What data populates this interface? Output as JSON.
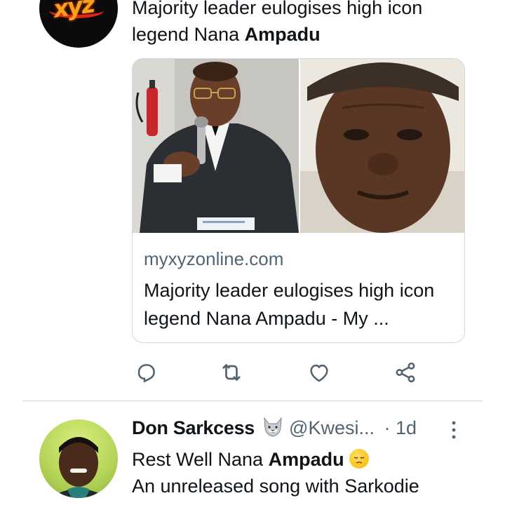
{
  "tweet1": {
    "avatar_icon": "xyz-logo-icon",
    "avatar_logo_text": "xyz",
    "text_prefix": "Majority leader eulogises high icon legend Nana ",
    "text_bold": "Ampadu",
    "card": {
      "domain": "myxyzonline.com",
      "title": "Majority leader eulogises high icon legend Nana Ampadu - My ..."
    },
    "actions": {
      "reply_icon": "reply-icon",
      "retweet_icon": "retweet-icon",
      "like_icon": "like-icon",
      "share_icon": "share-icon"
    }
  },
  "tweet2": {
    "display_name": "Don Sarkcess",
    "name_emoji_icon": "wolf-emoji-icon",
    "handle": "@Kwesi...",
    "time": "· 1d",
    "text_line1_prefix": "Rest Well Nana ",
    "text_line1_bold": "Ampadu",
    "text_line1_emoji_icon": "pensive-face-emoji-icon",
    "text_line2": "An unreleased song with Sarkodie"
  },
  "colors": {
    "text_primary": "#0f1419",
    "text_secondary": "#536471",
    "border": "#cfd9de"
  }
}
